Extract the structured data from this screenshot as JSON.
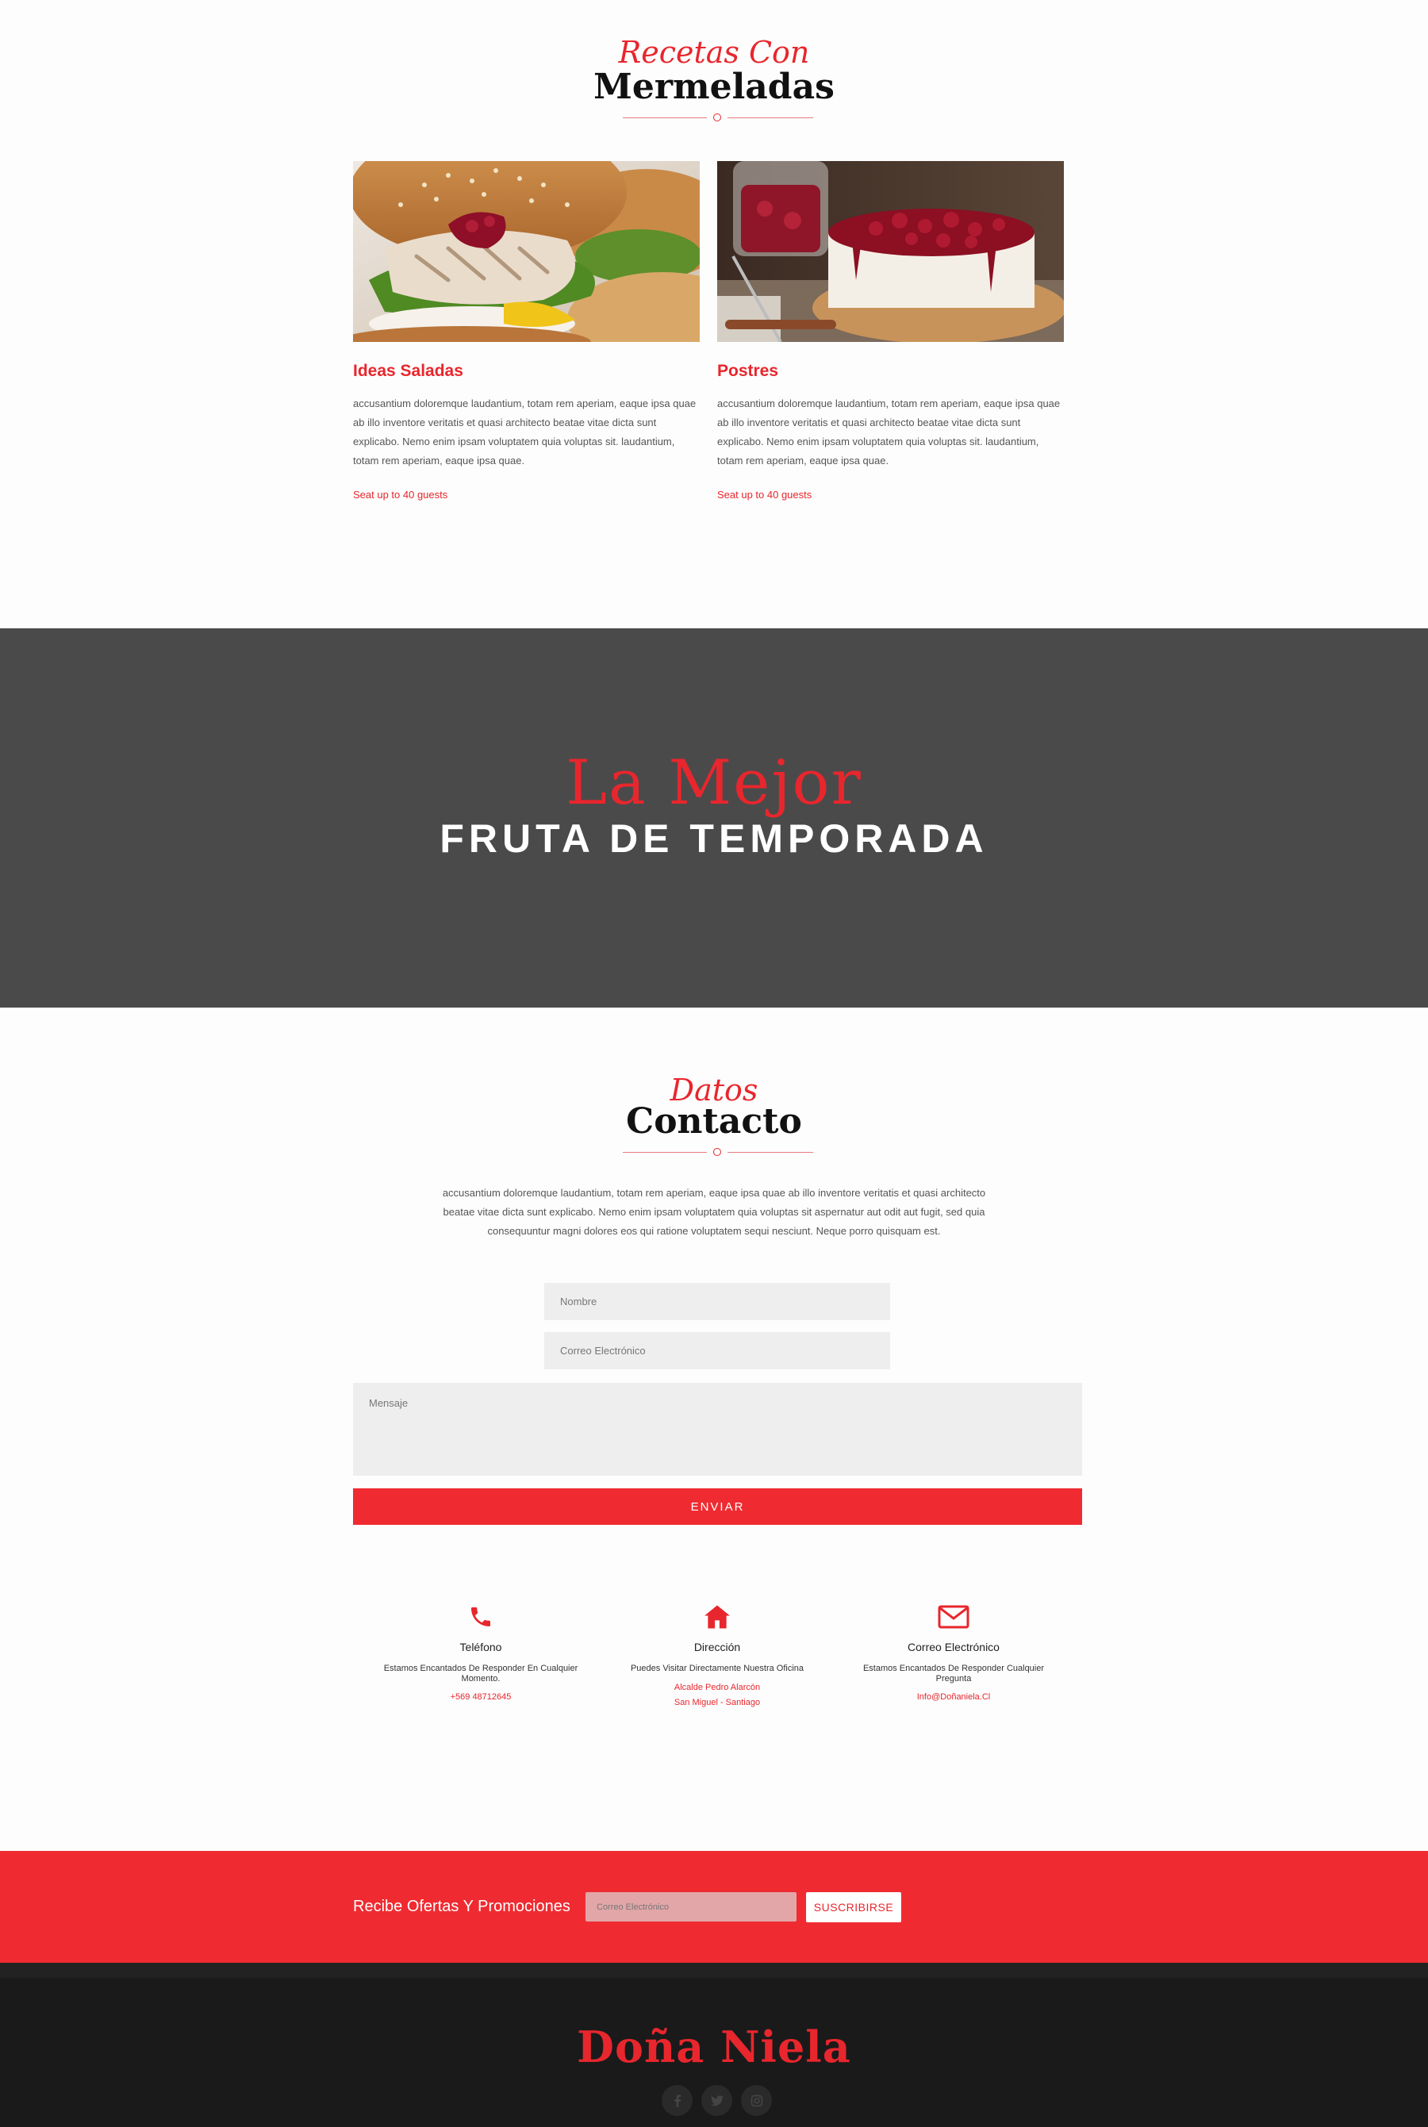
{
  "recetas": {
    "script_title": "Recetas Con",
    "title": "Mermeladas",
    "cards": [
      {
        "title": "Ideas Saladas",
        "text": "accusantium doloremque laudantium, totam rem aperiam, eaque ipsa quae ab illo inventore veritatis et quasi architecto beatae vitae dicta sunt explicabo. Nemo enim ipsam voluptatem quia voluptas sit. laudantium, totam rem aperiam, eaque ipsa quae.",
        "link": "Seat up to 40 guests",
        "image": "chicken-burger-with-berry-jam"
      },
      {
        "title": "Postres",
        "text": "accusantium doloremque laudantium, totam rem aperiam, eaque ipsa quae ab illo inventore veritatis et quasi architecto beatae vitae dicta sunt explicabo. Nemo enim ipsam voluptatem quia voluptas sit. laudantium, totam rem aperiam, eaque ipsa quae.",
        "link": "Seat up to 40 guests",
        "image": "cheesecake-with-cherry-jam"
      }
    ]
  },
  "banner": {
    "script": "La  Mejor",
    "caps": "FRUTA DE TEMPORADA"
  },
  "contacto": {
    "script_title": "Datos",
    "title": "Contacto",
    "intro": "accusantium doloremque laudantium, totam rem aperiam, eaque ipsa quae ab illo inventore veritatis et quasi architecto beatae vitae dicta sunt explicabo. Nemo enim ipsam voluptatem quia voluptas sit aspernatur aut odit aut fugit, sed quia consequuntur magni dolores eos qui ratione voluptatem sequi nesciunt. Neque porro quisquam est.",
    "form": {
      "name_placeholder": "Nombre",
      "email_placeholder": "Correo Electrónico",
      "message_placeholder": "Mensaje",
      "submit_label": "ENVIAR"
    },
    "info": [
      {
        "icon": "phone-icon",
        "title": "Teléfono",
        "desc": "Estamos Encantados De Responder En Cualquier Momento.",
        "value_lines": [
          "+569 48712645"
        ]
      },
      {
        "icon": "home-icon",
        "title": "Dirección",
        "desc": "Puedes Visitar Directamente Nuestra Oficina",
        "value_lines": [
          "Alcalde Pedro Alarcón",
          "San Miguel - Santiago"
        ]
      },
      {
        "icon": "envelope-icon",
        "title": "Correo Electrónico",
        "desc": "Estamos Encantados De Responder Cualquier Pregunta",
        "value_lines": [
          "Info@Doñaniela.Cl"
        ]
      }
    ]
  },
  "newsletter": {
    "label": "Recibe Ofertas Y Promociones",
    "email_placeholder": "Correo Electrónico",
    "button_label": "SUSCRIBIRSE"
  },
  "footer": {
    "brand": "Doña Niela",
    "socials": [
      "facebook-icon",
      "twitter-icon",
      "instagram-icon"
    ]
  },
  "colors": {
    "accent": "#e8262d",
    "button_red": "#ef2b31",
    "banner_bg": "#4a4a4a",
    "footer_bg": "#1a1a1a"
  }
}
